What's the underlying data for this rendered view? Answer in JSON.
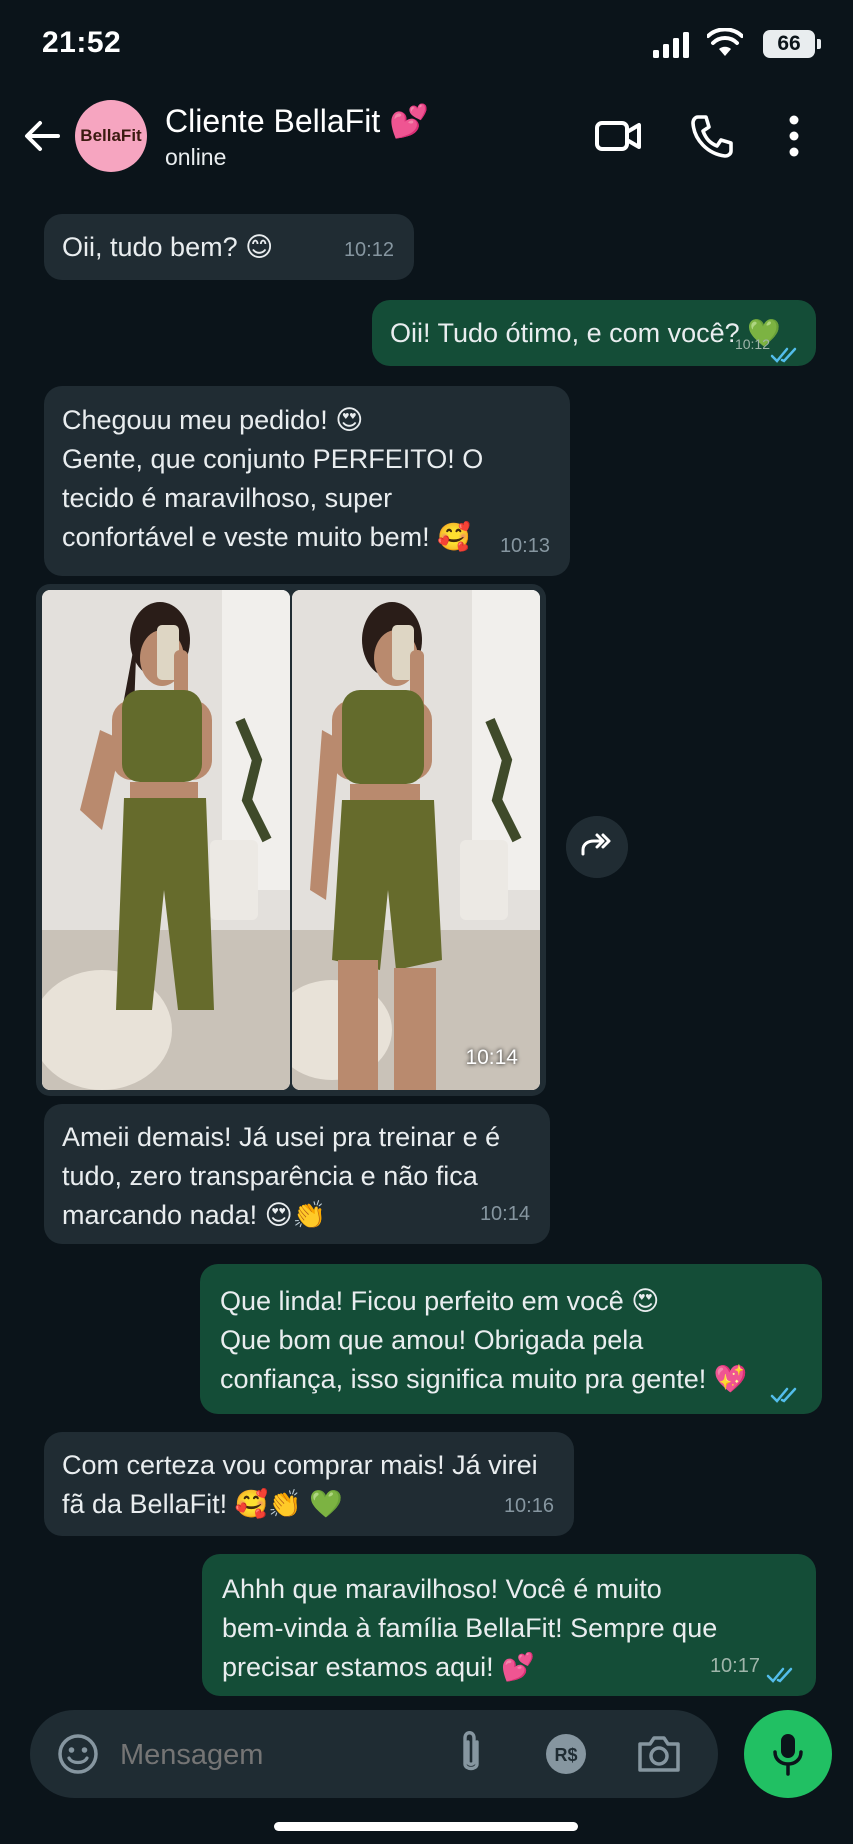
{
  "status_bar": {
    "time": "21:52",
    "battery": "66"
  },
  "header": {
    "avatar_text": "BellaFit",
    "name": "Cliente BellaFit 💕",
    "status": "online"
  },
  "messages": [
    {
      "dir": "in",
      "text_lines": [
        "Oii, tudo bem? 😊"
      ],
      "time": "10:12"
    },
    {
      "dir": "out",
      "text_lines": [
        "Oii! Tudo ótimo, e com você? 💚"
      ],
      "time": "10:12"
    },
    {
      "dir": "in",
      "text_lines": [
        "Chegouu meu pedido! 😍",
        "Gente, que conjunto PERFEITO! O",
        "tecido é maravilhoso, super",
        "confortável e veste muito bem! 🥰"
      ],
      "time": "10:13"
    },
    {
      "dir": "in",
      "type": "photos",
      "time": "10:14"
    },
    {
      "dir": "in",
      "text_lines": [
        "Ameii demais! Já usei pra treinar e é",
        "tudo, zero transparência e não fica",
        "marcando nada! 😍👏"
      ],
      "time": "10:14"
    },
    {
      "dir": "out",
      "text_lines": [
        "Que linda! Ficou perfeito em você 😍",
        "Que bom que amou! Obrigada pela",
        "confiança, isso significa muito pra gente! 💖"
      ],
      "time": ""
    },
    {
      "dir": "in",
      "text_lines": [
        "Com certeza vou comprar mais! Já virei",
        "fã da BellaFit! 🥰👏 💚"
      ],
      "time": "10:16"
    },
    {
      "dir": "out",
      "text_lines": [
        "Ahhh que maravilhoso! Você é muito",
        "bem-vinda à família BellaFit! Sempre que",
        "precisar estamos aqui! 💕"
      ],
      "time": "10:17"
    }
  ],
  "input": {
    "placeholder": "Mensagem"
  },
  "colors": {
    "incoming": "#202c33",
    "outgoing": "#144d37",
    "accent": "#21c063",
    "read_ticks": "#53bdeb"
  },
  "icons": [
    "back-arrow-icon",
    "video-call-icon",
    "phone-icon",
    "more-vert-icon",
    "emoji-icon",
    "attach-icon",
    "payment-icon",
    "camera-icon",
    "mic-icon",
    "forward-icon"
  ]
}
